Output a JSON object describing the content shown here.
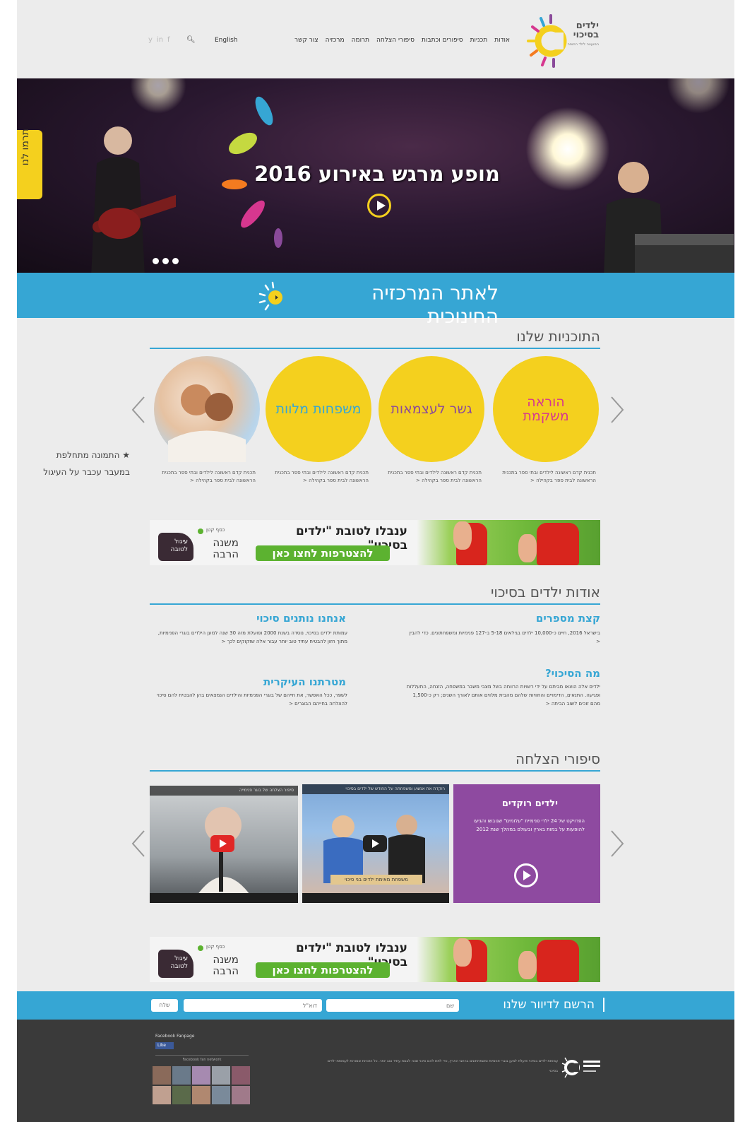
{
  "header": {
    "logo_line1": "ילדים",
    "logo_line2": "בסיכוי",
    "logo_sub": "המועצה לילד החוסה",
    "nav": [
      "אודות",
      "תכניות",
      "סיפורים וכתבות",
      "סיפורי הצלחה",
      "תרומה",
      "מרכזיה",
      "צור קשר"
    ],
    "lang": "English"
  },
  "hero": {
    "title": "מופע מרגש באירוע 2016",
    "donate_tab": "תרמו לנו"
  },
  "edu_bar": {
    "label": "לאתר המרכזיה החינוכית"
  },
  "programs": {
    "heading": "התוכניות שלנו",
    "items": [
      {
        "title": "הוראה משקמת",
        "desc": "תכנית קדם ראשונה לילדים ובתי ספר בתכנית הראשונה לבית ספר בקהילה <",
        "color": "#d6378f"
      },
      {
        "title": "גשר לעצמאות",
        "desc": "תכנית קדם ראשונה לילדים ובתי ספר בתכנית הראשונה לבית ספר בקהילה <",
        "color": "#8a4a9a"
      },
      {
        "title": "משפחות מלוות",
        "desc": "תכנית קדם ראשונה לילדים ובתי ספר בתכנית הראשונה לבית ספר בקהילה <",
        "color": "#36a6d4"
      },
      {
        "title": "",
        "desc": "תכנית קדם ראשונה לילדים ובתי ספר בתכנית הראשונה לבית ספר בקהילה <",
        "color": ""
      }
    ],
    "side_note_line1": "התמונה מתחלפת",
    "side_note_line2": "במעבר עכבר על העיגול",
    "side_note_star": "★"
  },
  "banner": {
    "title": "ענבלו לטובת \"ילדים בסיכוי\"",
    "cta": "להצטרפות לחצו כאן",
    "kkl_small": "כסף קטן",
    "kkl_line1": "משנה",
    "kkl_line2": "הרבה",
    "kkl_box": "עיגול לטובה"
  },
  "about": {
    "heading": "אודות ילדים בסיכוי",
    "blocks": [
      {
        "title": "קצת מספרים",
        "text": "בישראל 2016, חיים כ-10,000 ילדים בגילאים 5-18 ב-127 פנימיות ומשפחתונים. כדי להבין <"
      },
      {
        "title": "אנחנו נותנים סיכוי",
        "text": "עמותת ילדים בסיכוי, נוסדה בשנת 2000 ופועלת מזה 30 שנה למען הילדים בוגרי הפנימיות, מתוך חזון להבטיח עתיד טוב יותר עבור אלה שזקוקים לכך <"
      },
      {
        "title": "מה הסיכוי?",
        "text": "ילדים אלה הוצאו מביתם על ידי רשויות הרווחה בשל מצבי משבר במשפחה, הזנחה, התעללות ופגיעה. התנאים, הדימויים והחוויות שלהם מהבית מלווים אותם לאורך השנים; רק כ-1,500 מהם זוכים לשוב הביתה <"
      },
      {
        "title": "מטרתנו העיקרית",
        "text": "לשפר, ככל האפשר, את חייהם של בוגרי הפנימיות והילדים הנמצאים בהן להבטיח להם סיכוי להצלחה בחייהם הבוגרים <"
      }
    ]
  },
  "stories": {
    "heading": "סיפורי הצלחה",
    "card_title": "ילדים רוקדים",
    "card_desc": "הפרויקט של 24 ילדי פנימיית \"עלומים\" שגובשו והגיעו להופעות על במות בארץ ובעולם במהלך שנת 2012",
    "video2_caption": "משפחת מאימת ילדים בני סיכוי",
    "video1_caption": "סיפור הצלחה של בוגר פנימייה",
    "video2_top": "רוקדת את אמצע ומשפחתה על החודש של ילדים בסיכוי"
  },
  "newsletter": {
    "label": "הרשם לדיוור שלנו",
    "name_placeholder": "שם",
    "email_placeholder": "דוא\"ל",
    "submit": "שלח"
  },
  "footer": {
    "fb_title": "Facebook Fanpage",
    "fb_like": "Like",
    "fb_fans": "Facebook fan network",
    "text": "עמותת ילדים בסיכוי פועלת למען בוגרי פנימיות ומשפחתונים ברחבי הארץ, כדי לתת להם סיכוי שווה לבנות עתיד טוב יותר. כל הזכויות שמורות לעמותת ילדים בסיכוי"
  },
  "colors": {
    "accent_blue": "#36a6d4",
    "accent_yellow": "#f4d01e",
    "purple": "#8e4aa0",
    "footer": "#3a3a3a"
  }
}
